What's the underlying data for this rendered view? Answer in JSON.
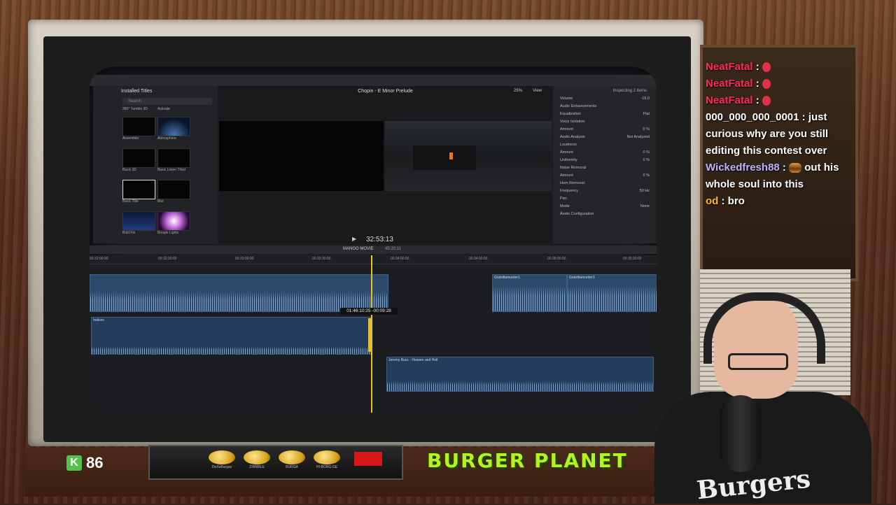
{
  "stream": {
    "brand_title": "BURGER PLANET",
    "k_count": "86",
    "k_icon": "K",
    "knob_labels": [
      "DeXaBurgas",
      "ZIRMBLE",
      "BURGA",
      "HI-BORG-GE"
    ]
  },
  "chat": {
    "messages": [
      {
        "user": "NeatFatal",
        "sep": " :",
        "text": ""
      },
      {
        "user": "NeatFatal",
        "sep": " :",
        "text": ""
      },
      {
        "user": "NeatFatal",
        "sep": " :",
        "text": ""
      },
      {
        "user": "000_000_000_0001",
        "sep": " : ",
        "text": "just curious why are you still editing this contest over"
      },
      {
        "user": "Wickedfresh88",
        "sep": " : ",
        "text": "out his whole soul into this"
      },
      {
        "user": "od",
        "sep": " : ",
        "text": "bro"
      }
    ]
  },
  "shirt_text": "Burgers",
  "fcp": {
    "library": {
      "header": "Installed Titles",
      "search_placeholder": "Search",
      "top_labels": [
        "360° Tumble 3D",
        "Activate"
      ],
      "thumbs": [
        {
          "label": "Assembler"
        },
        {
          "label": "Atmosphere"
        },
        {
          "label": "Basic 3D"
        },
        {
          "label": "Basic Lower Third"
        },
        {
          "label": "Basic Title"
        },
        {
          "label": "Blur"
        },
        {
          "label": "Bold Fin"
        },
        {
          "label": "Boogie Lights"
        }
      ]
    },
    "viewer": {
      "title": "Chopin - E Minor Prelude",
      "zoom": "25%",
      "view_label": "View",
      "timecode": "32:53:13"
    },
    "inspector": {
      "title": "Inspecting 2 items",
      "rows": [
        {
          "label": "Volume",
          "value": "-16.0"
        },
        {
          "label": "Audio Enhancements",
          "value": ""
        },
        {
          "label": "Equalization",
          "value": "Flat"
        },
        {
          "label": "Voice Isolation",
          "value": ""
        },
        {
          "label": "Amount",
          "value": "0 %"
        },
        {
          "label": "Audio Analysis",
          "value": "Not Analyzed"
        },
        {
          "label": "Loudness",
          "value": ""
        },
        {
          "label": "Amount",
          "value": "0 %"
        },
        {
          "label": "Uniformity",
          "value": "0 %"
        },
        {
          "label": "Noise Removal",
          "value": ""
        },
        {
          "label": "Amount",
          "value": "0 %"
        },
        {
          "label": "Hum Removal",
          "value": ""
        },
        {
          "label": "Frequency",
          "value": "50 Hz"
        },
        {
          "label": "Pan",
          "value": ""
        },
        {
          "label": "Mode",
          "value": "None"
        },
        {
          "label": "Audio Configuration",
          "value": ""
        }
      ]
    },
    "timeline": {
      "project": "MANGO MOVIE",
      "duration": "45:20:11",
      "ruler": [
        "00:32:00:00",
        "00:32:30:00",
        "00:33:00:00",
        "00:33:30:00",
        "00:34:00:00",
        "00:34:30:00",
        "00:35:00:00",
        "00:35:30:00"
      ],
      "tooltip": "01:46:10:25  -00:09:28",
      "clips": [
        {
          "label": ""
        },
        {
          "label": "Indices"
        },
        {
          "label": "Godzillamurder1"
        },
        {
          "label": "Godzillamurder1"
        },
        {
          "label": "Jeremy Bucc - Heaven and Hell"
        }
      ]
    }
  }
}
